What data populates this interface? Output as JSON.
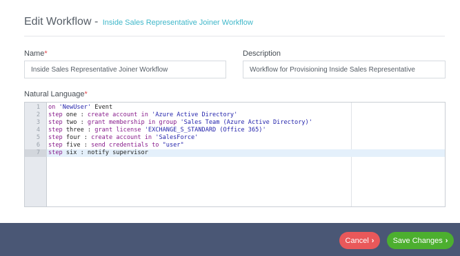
{
  "header": {
    "title": "Edit Workflow -",
    "subtitle": "Inside Sales Representative Joiner Workflow"
  },
  "form": {
    "name_label": "Name",
    "name_required": "*",
    "name_value": "Inside Sales Representative Joiner Workflow",
    "description_label": "Description",
    "description_value": "Workflow for Provisioning Inside Sales Representative",
    "nl_label": "Natural Language",
    "nl_required": "*"
  },
  "editor": {
    "active_line": 7,
    "lines": [
      {
        "num": "1",
        "tokens": [
          {
            "t": "on ",
            "c": "kw"
          },
          {
            "t": "'NewUser'",
            "c": "str"
          },
          {
            "t": " Event",
            "c": "plain"
          }
        ]
      },
      {
        "num": "2",
        "tokens": [
          {
            "t": "step",
            "c": "kw"
          },
          {
            "t": " one : ",
            "c": "plain"
          },
          {
            "t": "create account in",
            "c": "kw"
          },
          {
            "t": " ",
            "c": "plain"
          },
          {
            "t": "'Azure Active Directory'",
            "c": "str"
          }
        ]
      },
      {
        "num": "3",
        "tokens": [
          {
            "t": "step",
            "c": "kw"
          },
          {
            "t": " two : ",
            "c": "plain"
          },
          {
            "t": "grant membership in group",
            "c": "kw"
          },
          {
            "t": " ",
            "c": "plain"
          },
          {
            "t": "'Sales Team (Azure Active Directory)'",
            "c": "str"
          }
        ]
      },
      {
        "num": "4",
        "tokens": [
          {
            "t": "step",
            "c": "kw"
          },
          {
            "t": " three : ",
            "c": "plain"
          },
          {
            "t": "grant license",
            "c": "kw"
          },
          {
            "t": " ",
            "c": "plain"
          },
          {
            "t": "'EXCHANGE_S_STANDARD (Office 365)'",
            "c": "str"
          }
        ]
      },
      {
        "num": "5",
        "tokens": [
          {
            "t": "step",
            "c": "kw"
          },
          {
            "t": " four : ",
            "c": "plain"
          },
          {
            "t": "create account in",
            "c": "kw"
          },
          {
            "t": " ",
            "c": "plain"
          },
          {
            "t": "'SalesForce'",
            "c": "str"
          }
        ]
      },
      {
        "num": "6",
        "tokens": [
          {
            "t": "step",
            "c": "kw"
          },
          {
            "t": " five : ",
            "c": "plain"
          },
          {
            "t": "send credentials to",
            "c": "kw"
          },
          {
            "t": " ",
            "c": "plain"
          },
          {
            "t": "\"user\"",
            "c": "str"
          }
        ]
      },
      {
        "num": "7",
        "tokens": [
          {
            "t": "step",
            "c": "kw"
          },
          {
            "t": " six : notify supervisor",
            "c": "plain"
          }
        ]
      }
    ]
  },
  "footer": {
    "cancel_label": "Cancel",
    "save_label": "Save Changes",
    "chevron": "›"
  },
  "colors": {
    "accent": "#3fb7c9",
    "cancel": "#e9585a",
    "save": "#4caf2f",
    "backdrop": "#4a5775"
  }
}
